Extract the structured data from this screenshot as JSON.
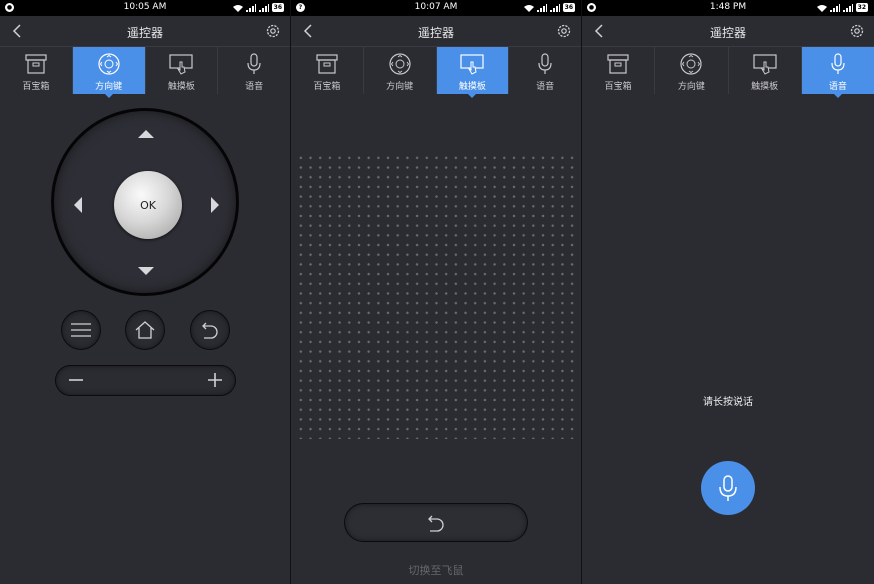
{
  "app_title": "遥控器",
  "tabs": [
    {
      "label": "百宝箱",
      "icon": "box-icon"
    },
    {
      "label": "方向键",
      "icon": "dpad-icon"
    },
    {
      "label": "触摸板",
      "icon": "touchpad-icon"
    },
    {
      "label": "语音",
      "icon": "microphone-icon"
    }
  ],
  "screens": [
    {
      "time": "10:05 AM",
      "battery": "36",
      "active_tab": 1
    },
    {
      "time": "10:07 AM",
      "battery": "36",
      "active_tab": 2
    },
    {
      "time": "1:48 PM",
      "battery": "32",
      "active_tab": 3
    }
  ],
  "dpad": {
    "ok_label": "OK"
  },
  "touchpad_screen": {
    "switch_label": "切换至飞鼠"
  },
  "voice_screen": {
    "hint": "请长按说话"
  },
  "colors": {
    "accent": "#4a90e8",
    "background": "#2b2c32"
  }
}
